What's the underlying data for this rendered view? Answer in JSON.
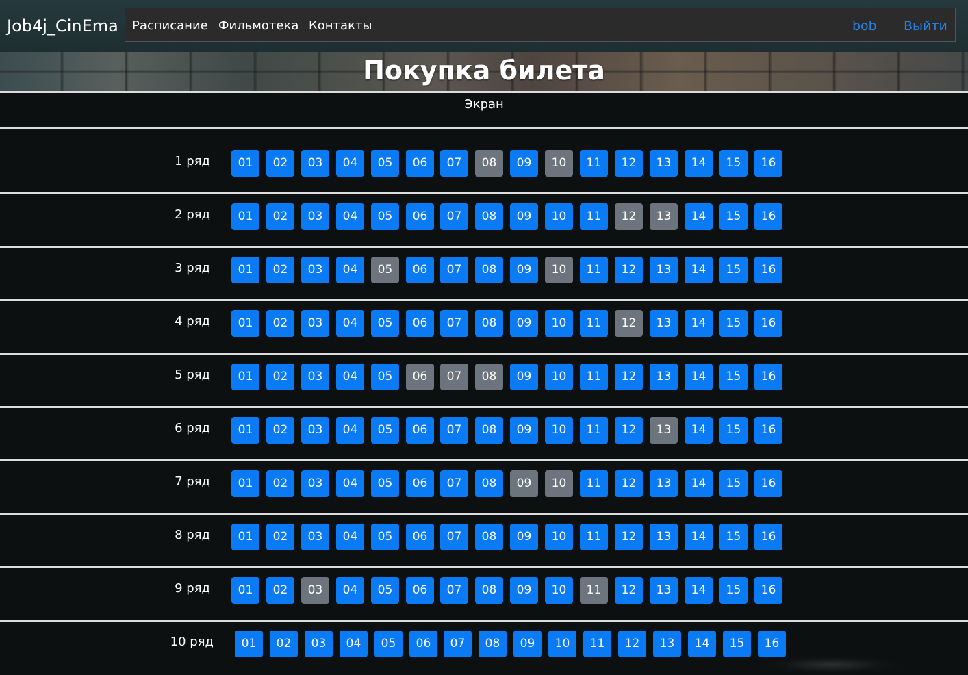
{
  "brand": "Job4j_CinEma",
  "nav": {
    "schedule": "Расписание",
    "films": "Фильмотека",
    "contacts": "Контакты",
    "user": "bob",
    "logout": "Выйти"
  },
  "page_title": "Покупка билета",
  "screen_label": "Экран",
  "colors": {
    "free_seat": "#0a7bf5",
    "taken_seat": "#6c757d",
    "link": "#2a82e6",
    "background": "#0c1011"
  },
  "seat_numbers": [
    "01",
    "02",
    "03",
    "04",
    "05",
    "06",
    "07",
    "08",
    "09",
    "10",
    "11",
    "12",
    "13",
    "14",
    "15",
    "16"
  ],
  "rows": [
    {
      "label": "1 ряд",
      "taken": [
        "08",
        "10"
      ]
    },
    {
      "label": "2 ряд",
      "taken": [
        "12",
        "13"
      ]
    },
    {
      "label": "3 ряд",
      "taken": [
        "05",
        "10"
      ]
    },
    {
      "label": "4 ряд",
      "taken": [
        "12"
      ]
    },
    {
      "label": "5 ряд",
      "taken": [
        "06",
        "07",
        "08"
      ]
    },
    {
      "label": "6 ряд",
      "taken": [
        "13"
      ]
    },
    {
      "label": "7 ряд",
      "taken": [
        "09",
        "10"
      ]
    },
    {
      "label": "8 ряд",
      "taken": []
    },
    {
      "label": "9 ряд",
      "taken": [
        "03",
        "11"
      ]
    },
    {
      "label": "10 ряд",
      "taken": []
    }
  ]
}
